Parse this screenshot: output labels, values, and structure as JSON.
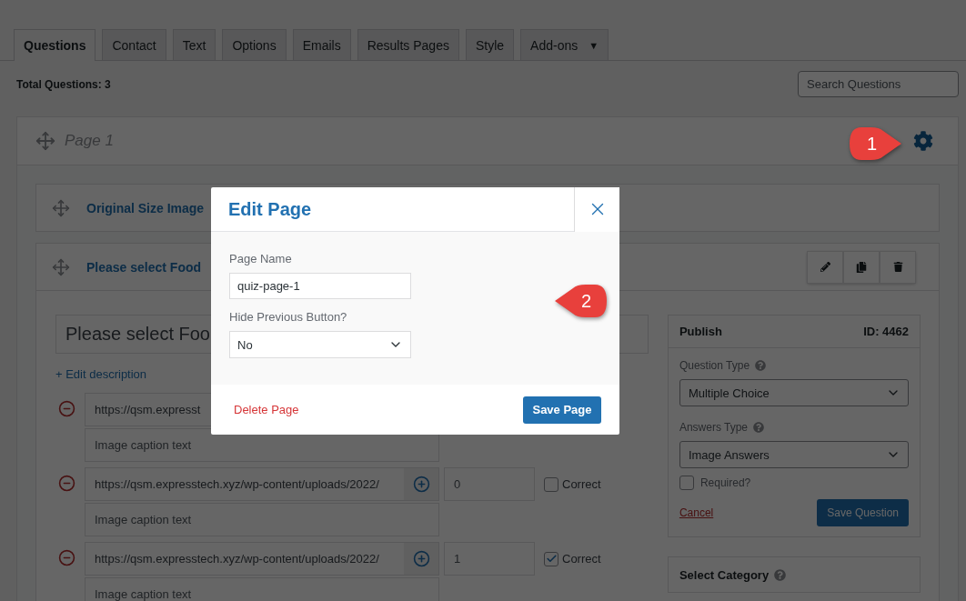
{
  "tabs": [
    {
      "label": "Questions",
      "selected": true
    },
    {
      "label": "Contact",
      "selected": false
    },
    {
      "label": "Text",
      "selected": false
    },
    {
      "label": "Options",
      "selected": false
    },
    {
      "label": "Emails",
      "selected": false
    },
    {
      "label": "Results Pages",
      "selected": false
    },
    {
      "label": "Style",
      "selected": false
    },
    {
      "label": "Add-ons",
      "selected": false,
      "caret": "▼"
    }
  ],
  "total_questions": "Total Questions: 3",
  "search": {
    "placeholder": "Search Questions"
  },
  "page": {
    "title": "Page 1"
  },
  "questions": [
    {
      "title": "Original Size Image"
    },
    {
      "title": "Please select Food"
    }
  ],
  "editor": {
    "question_text": "Please select Foo",
    "edit_description": "+ Edit description",
    "answers": [
      {
        "url": "https://qsm.expresst",
        "caption": "Image caption text"
      },
      {
        "url": "https://qsm.expresstech.xyz/wp-content/uploads/2022/",
        "caption": "Image caption text",
        "points": "0",
        "correct": false,
        "correct_label": "Correct"
      },
      {
        "url": "https://qsm.expresstech.xyz/wp-content/uploads/2022/",
        "caption": "Image caption text",
        "points": "1",
        "correct": true,
        "correct_label": "Correct"
      }
    ]
  },
  "publish": {
    "title": "Publish",
    "id": "ID: 4462",
    "question_type_label": "Question Type",
    "question_type": "Multiple Choice",
    "answers_type_label": "Answers Type",
    "answers_type": "Image Answers",
    "required": {
      "label": "Required?",
      "checked": false
    },
    "cancel": "Cancel",
    "save": "Save Question"
  },
  "select_category": "Select Category",
  "modal": {
    "title": "Edit Page",
    "page_name_label": "Page Name",
    "page_name": "quiz-page-1",
    "hide_prev_label": "Hide Previous Button?",
    "hide_prev": "No",
    "delete": "Delete Page",
    "save": "Save Page"
  },
  "callouts": [
    "1",
    "2"
  ]
}
